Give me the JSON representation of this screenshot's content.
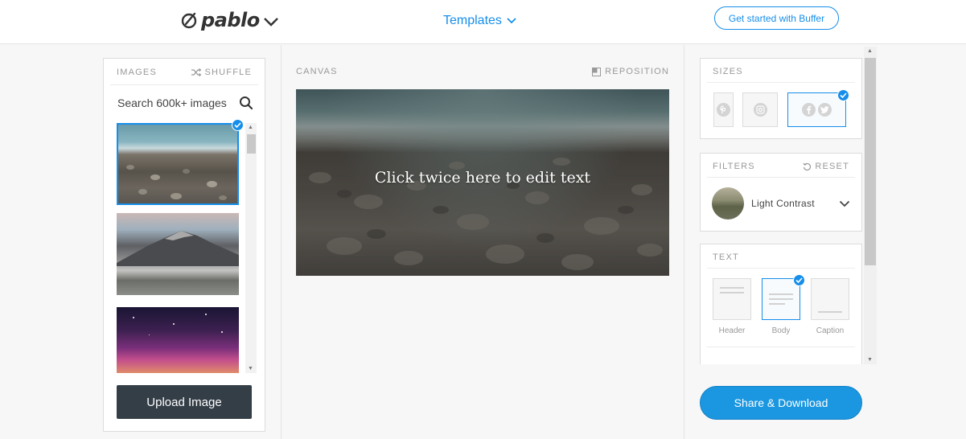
{
  "header": {
    "logo_text": "pablo",
    "templates_label": "Templates",
    "cta_label": "Get started with Buffer"
  },
  "images_panel": {
    "title": "IMAGES",
    "shuffle_label": "SHUFFLE",
    "search_placeholder": "Search 600k+ images",
    "thumbnails": [
      {
        "name": "pebble-beach",
        "selected": true
      },
      {
        "name": "misty-mountain",
        "selected": false
      },
      {
        "name": "night-sky",
        "selected": false
      }
    ],
    "upload_label": "Upload Image"
  },
  "canvas": {
    "title": "CANVAS",
    "reposition_label": "REPOSITION",
    "text": "Click twice here to edit text"
  },
  "sizes": {
    "title": "SIZES",
    "options": [
      {
        "name": "pinterest",
        "icons": [
          "pinterest-icon"
        ],
        "selected": false
      },
      {
        "name": "instagram",
        "icons": [
          "instagram-icon"
        ],
        "selected": false
      },
      {
        "name": "facebook-twitter",
        "icons": [
          "facebook-icon",
          "twitter-icon"
        ],
        "selected": true
      }
    ]
  },
  "filters": {
    "title": "FILTERS",
    "reset_label": "RESET",
    "selected_filter": "Light Contrast"
  },
  "text_panel": {
    "title": "TEXT",
    "options": [
      {
        "label": "Header",
        "selected": false
      },
      {
        "label": "Body",
        "selected": true
      },
      {
        "label": "Caption",
        "selected": false
      }
    ]
  },
  "share_label": "Share & Download",
  "colors": {
    "accent": "#168eea",
    "upload_button": "#343e47",
    "share_button": "#1a97e0"
  }
}
